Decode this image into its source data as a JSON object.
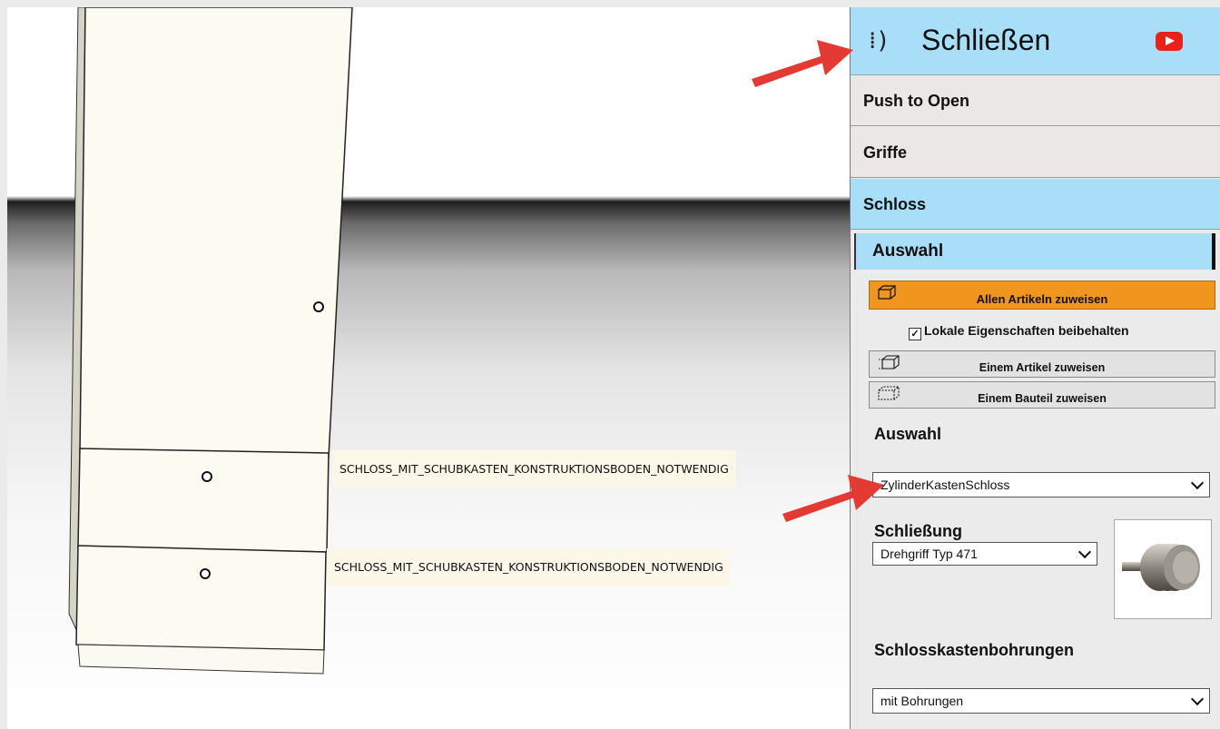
{
  "viewport": {
    "label_1": "SCHLOSS_MIT_SCHUBKASTEN_KONSTRUKTIONSBODEN_NOTWENDIG",
    "label_2": "SCHLOSS_MIT_SCHUBKASTEN_KONSTRUKTIONSBODEN_NOTWENDIG"
  },
  "panel": {
    "header": {
      "title": "Schließen",
      "icon": "lock-open-icon",
      "video_icon": "youtube-icon"
    },
    "sections": [
      "Push to Open",
      "Griffe",
      "Schloss"
    ],
    "subsection": "Auswahl",
    "buttons": {
      "assign_all": "Allen Artikeln zuweisen",
      "assign_article": "Einem Artikel zuweisen",
      "assign_part": "Einem Bauteil zuweisen"
    },
    "keep_local": {
      "label": "Lokale Eigenschaften beibehalten",
      "checked": true
    },
    "selection": {
      "heading": "Auswahl",
      "value": "ZylinderKastenSchloss"
    },
    "locking": {
      "heading": "Schließung",
      "value": "Drehgriff Typ 471"
    },
    "holes": {
      "heading": "Schlosskastenbohrungen",
      "value": "mit Bohrungen"
    }
  },
  "colors": {
    "header_bg": "#a8def7",
    "active_bg": "#a8def7",
    "assign_all_bg": "#f0951e",
    "arrow": "#e33b34"
  }
}
